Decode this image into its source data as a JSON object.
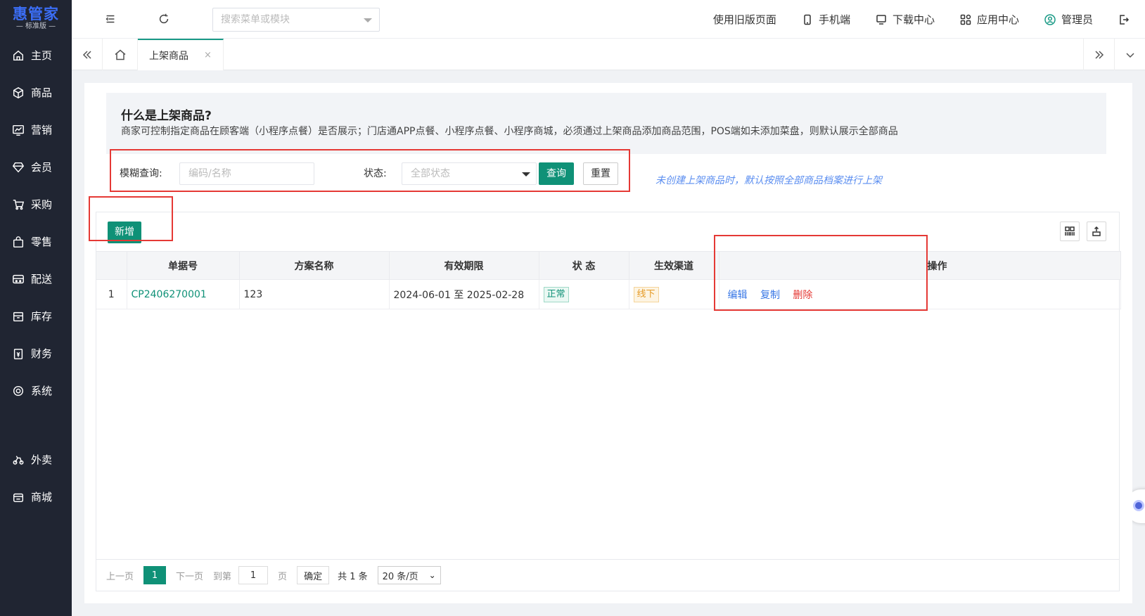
{
  "sidebar": {
    "brand": "惠管家",
    "edition": "— 标准版 —",
    "items": [
      {
        "label": "主页",
        "icon": "home-icon"
      },
      {
        "label": "商品",
        "icon": "cube-icon"
      },
      {
        "label": "营销",
        "icon": "chart-icon"
      },
      {
        "label": "会员",
        "icon": "diamond-icon"
      },
      {
        "label": "采购",
        "icon": "cart-icon"
      },
      {
        "label": "零售",
        "icon": "bag-icon"
      },
      {
        "label": "配送",
        "icon": "truck-icon"
      },
      {
        "label": "库存",
        "icon": "inventory-icon"
      },
      {
        "label": "财务",
        "icon": "finance-icon"
      },
      {
        "label": "系统",
        "icon": "settings-icon"
      },
      {
        "label": "外卖",
        "icon": "delivery-icon"
      },
      {
        "label": "商城",
        "icon": "store-icon"
      }
    ]
  },
  "topbar": {
    "menu_search_placeholder": "搜索菜单或模块",
    "links": {
      "old_page": "使用旧版页面",
      "mobile": "手机端",
      "download": "下载中心",
      "apps": "应用中心",
      "user": "管理员"
    }
  },
  "tabs": {
    "active": "上架商品",
    "close": "×"
  },
  "intro": {
    "title": "什么是上架商品?",
    "text": "商家可控制指定商品在顾客端（小程序点餐）是否展示；门店通APP点餐、小程序点餐、小程序商城，必须通过上架商品添加商品范围，POS端如未添加菜盘，则默认展示全部商品"
  },
  "filters": {
    "keyword_label": "模糊查询:",
    "keyword_placeholder": "编码/名称",
    "status_label": "状态:",
    "status_value": "全部状态",
    "query_btn": "查询",
    "reset_btn": "重置",
    "hint": "未创建上架商品时，默认按照全部商品档案进行上架"
  },
  "toolbar": {
    "add_btn": "新增"
  },
  "table": {
    "headers": [
      "",
      "单据号",
      "方案名称",
      "有效期限",
      "状 态",
      "生效渠道",
      "操作"
    ],
    "rows": [
      {
        "index": "1",
        "code": "CP2406270001",
        "name": "123",
        "period": "2024-06-01 至 2025-02-28",
        "status": "正常",
        "channel": "线下",
        "actions": {
          "edit": "编辑",
          "copy": "复制",
          "delete": "删除"
        }
      }
    ]
  },
  "pager": {
    "prev": "上一页",
    "current": "1",
    "next": "下一页",
    "goto": "到第",
    "page_input": "1",
    "page_unit": "页",
    "confirm": "确定",
    "total": "共 1 条",
    "page_size": "20 条/页",
    "page_size_chevron": "⌄"
  },
  "colors": {
    "primary": "#0f9177",
    "sidebar_bg": "#202532",
    "highlight_box": "#e53935",
    "hint": "#5b8ef0"
  }
}
